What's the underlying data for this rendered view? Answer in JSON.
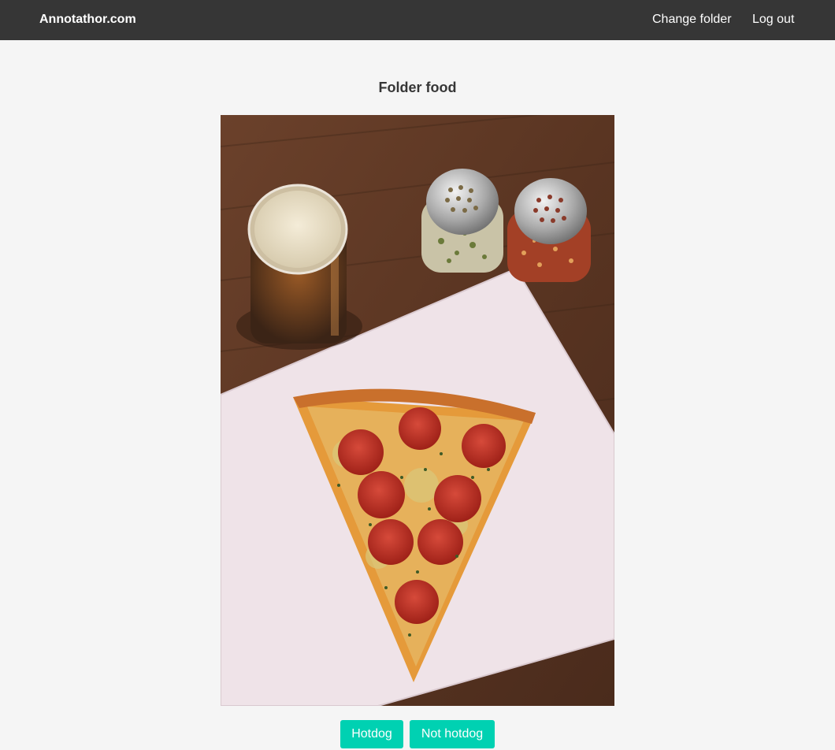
{
  "navbar": {
    "brand": "Annotathor.com",
    "links": {
      "change_folder": "Change folder",
      "logout": "Log out"
    }
  },
  "main": {
    "title": "Folder food",
    "image": {
      "subject": "pizza-slice-with-beer-and-shakers"
    },
    "buttons": {
      "hotdog": "Hotdog",
      "not_hotdog": "Not hotdog"
    }
  },
  "colors": {
    "navbar_bg": "#363636",
    "page_bg": "#f5f5f5",
    "button_bg": "#00d1b2",
    "button_text": "#ffffff"
  }
}
